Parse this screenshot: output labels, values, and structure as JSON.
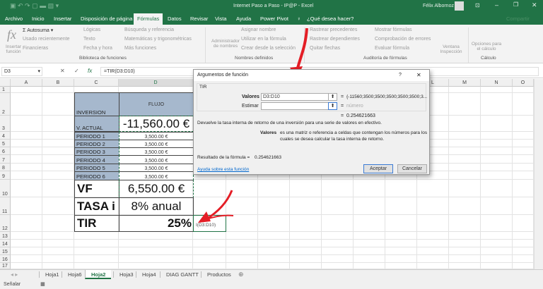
{
  "window": {
    "title": "Internet Paso a Paso - IP@P - Excel",
    "user": "Félix Albornoz"
  },
  "tabs": [
    "Archivo",
    "Inicio",
    "Insertar",
    "Disposición de página",
    "Fórmulas",
    "Datos",
    "Revisar",
    "Vista",
    "Ayuda",
    "Power Pivot"
  ],
  "active_tab": "Fórmulas",
  "tell_me": "¿Qué desea hacer?",
  "share": "Compartir",
  "ribbon": {
    "insert_function": "Insertar función",
    "autosum": "Autosuma",
    "recent": "Usado recientemente",
    "financial": "Financieras",
    "logical": "Lógicas",
    "text": "Texto",
    "datetime": "Fecha y hora",
    "lookup": "Búsqueda y referencia",
    "math": "Matemáticas y trigonométricas",
    "more": "Más funciones",
    "group_library": "Biblioteca de funciones",
    "name_manager": "Administrador de nombres",
    "define_name": "Asignar nombre",
    "use_in_formula": "Utilizar en la fórmula",
    "create_from_sel": "Crear desde la selección",
    "group_names": "Nombres definidos",
    "trace_prec": "Rastrear precedentes",
    "trace_dep": "Rastrear dependientes",
    "remove_arrows": "Quitar flechas",
    "show_formulas": "Mostrar fórmulas",
    "error_check": "Comprobación de errores",
    "evaluate": "Evaluar fórmula",
    "watch": "Ventana Inspección",
    "group_audit": "Auditoría de fórmulas",
    "calc_options": "Opciones para el cálculo",
    "group_calc": "Cálculo"
  },
  "formula_bar": {
    "name_box": "D3",
    "formula": "=TIR(D3:D10)"
  },
  "columns": [
    "A",
    "B",
    "C",
    "D",
    "E",
    "F",
    "G",
    "H",
    "I",
    "J",
    "K",
    "L",
    "M",
    "N",
    "O"
  ],
  "rows": [
    "1",
    "2",
    "3",
    "4",
    "5",
    "6",
    "7",
    "8",
    "9",
    "10",
    "11",
    "12",
    "13",
    "14",
    "15",
    "16",
    "17"
  ],
  "sheet": {
    "header_label": "INVERSION",
    "header_flow": "FLUJO",
    "v_actual_label": "V. ACTUAL",
    "v_actual": "-11,560.00 €",
    "periods": [
      {
        "label": "PERIODO 1",
        "value": "3,500.00 €"
      },
      {
        "label": "PERIODO 2",
        "value": "3,500.00 €"
      },
      {
        "label": "PERIODO 3",
        "value": "3,500.00 €"
      },
      {
        "label": "PERIODO 4",
        "value": "3,500.00 €"
      },
      {
        "label": "PERIODO 5",
        "value": "3,500.00 €"
      },
      {
        "label": "PERIODO 6",
        "value": "3,500.00 €"
      }
    ],
    "vf_label": "VF",
    "vf": "6,550.00 €",
    "tasa_label": "TASA i",
    "tasa": "8% anual",
    "tir_label": "TIR",
    "tir": "25%",
    "e12_edit": "I(D3:D10)"
  },
  "dialog": {
    "title": "Argumentos de función",
    "help": "?",
    "close": "✕",
    "func": "TIR",
    "valores_label": "Valores",
    "valores_value": "D3:D10",
    "valores_result": "{-11560;3500;3500;3500;3500;3500;3...",
    "estimar_label": "Estimar",
    "estimar_value": "",
    "estimar_result": "número",
    "eq": "=",
    "result_top": "0.254621663",
    "description": "Devuelve la tasa interna de retorno de una inversión para una serie de valores en efectivo.",
    "arg_name": "Valores",
    "arg_desc1": "es una matriz o referencia a celdas que contengan los números para los",
    "arg_desc2": "cuales se desea calcular la tasa interna de retorno.",
    "formula_result_label": "Resultado de la fórmula =",
    "formula_result": "0.254621663",
    "help_link": "Ayuda sobre esta función",
    "ok": "Aceptar",
    "cancel": "Cancelar"
  },
  "sheet_tabs": [
    "Hoja1",
    "Hoja6",
    "Hoja2",
    "Hoja3",
    "Hoja4",
    "DIAG GANTT",
    "Productos"
  ],
  "active_sheet": "Hoja2",
  "status": "Señalar"
}
